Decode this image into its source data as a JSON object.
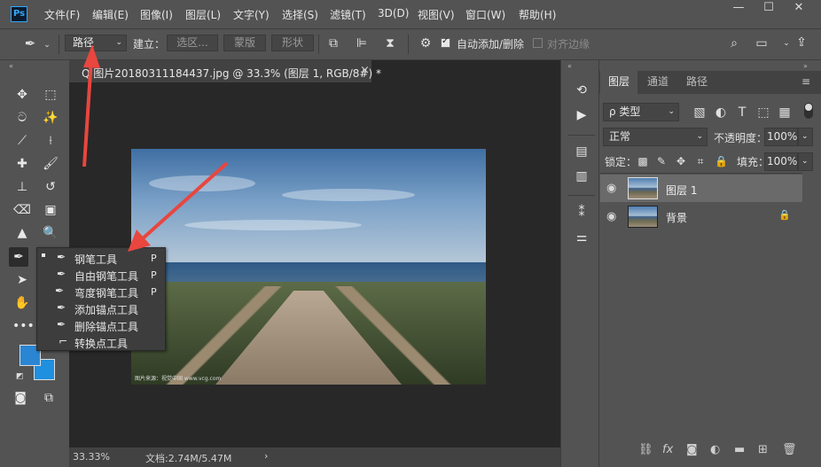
{
  "app": {
    "logo": "Ps"
  },
  "menu": [
    "文件(F)",
    "编辑(E)",
    "图像(I)",
    "图层(L)",
    "文字(Y)",
    "选择(S)",
    "滤镜(T)",
    "3D(D)",
    "视图(V)",
    "窗口(W)",
    "帮助(H)"
  ],
  "window_controls": {
    "minimize": "—",
    "maximize": "☐",
    "close": "✕"
  },
  "options": {
    "mode_value": "路径",
    "build_label": "建立：",
    "selection_btn": "选区...",
    "mask_btn": "蒙版",
    "shape_btn": "形状",
    "auto_add_delete": "自动添加/删除",
    "align_edges": "对齐边缘"
  },
  "document": {
    "tab_title": "Q 图片20180311184437.jpg @ 33.3% (图层 1, RGB/8#) *",
    "tab_close": "×",
    "watermark": "图片来源：视觉中国 www.vcg.com",
    "zoom": "33.33%",
    "doc_info": "文档:2.74M/5.47M",
    "status_arrow": "›"
  },
  "flyout": [
    {
      "label": "钢笔工具",
      "key": "P",
      "active": true
    },
    {
      "label": "自由钢笔工具",
      "key": "P",
      "active": false
    },
    {
      "label": "弯度钢笔工具",
      "key": "P",
      "active": false
    },
    {
      "label": "添加锚点工具",
      "key": "",
      "active": false
    },
    {
      "label": "删除锚点工具",
      "key": "",
      "active": false
    },
    {
      "label": "转换点工具",
      "key": "",
      "active": false
    }
  ],
  "panel": {
    "tabs": [
      "图层",
      "通道",
      "路径"
    ],
    "filter_kind": "ρ 类型",
    "blend_mode": "正常",
    "opacity_label": "不透明度：",
    "opacity_value": "100%",
    "lock_label": "锁定：",
    "fill_label": "填充：",
    "fill_value": "100%",
    "layers": [
      {
        "name": "图层 1",
        "selected": true,
        "locked": false
      },
      {
        "name": "背景",
        "selected": false,
        "locked": true
      }
    ]
  },
  "colors": {
    "foreground": "#2a86d3",
    "background": "#1f8fe0",
    "arrow": "#e8463f",
    "selected_row": "#6a6a6a"
  }
}
